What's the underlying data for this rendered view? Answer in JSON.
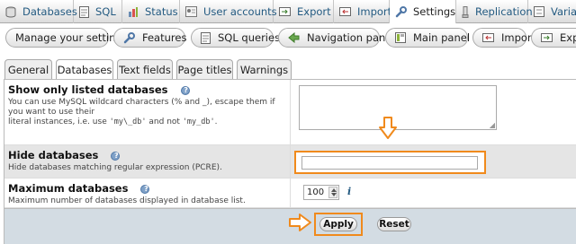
{
  "top_tabs": [
    {
      "label": "Databases",
      "icon": "database-icon"
    },
    {
      "label": "SQL",
      "icon": "sql-icon"
    },
    {
      "label": "Status",
      "icon": "status-icon"
    },
    {
      "label": "User accounts",
      "icon": "users-icon"
    },
    {
      "label": "Export",
      "icon": "export-icon"
    },
    {
      "label": "Import",
      "icon": "import-icon"
    },
    {
      "label": "Settings",
      "icon": "wrench-icon",
      "active": true
    },
    {
      "label": "Replication",
      "icon": "replication-icon"
    },
    {
      "label": "Variab",
      "icon": "variables-icon"
    }
  ],
  "sub_nav": [
    {
      "label": "Manage your settings"
    },
    {
      "label": "Features",
      "icon": "wrench-icon"
    },
    {
      "label": "SQL queries",
      "icon": "sql-icon"
    },
    {
      "label": "Navigation panel",
      "icon": "navigation-icon"
    },
    {
      "label": "Main panel",
      "icon": "main-panel-icon"
    },
    {
      "label": "Import",
      "icon": "import-icon"
    },
    {
      "label": "Expo",
      "icon": "export-icon"
    }
  ],
  "inner_tabs": [
    {
      "label": "General"
    },
    {
      "label": "Databases",
      "active": true
    },
    {
      "label": "Text fields"
    },
    {
      "label": "Page titles"
    },
    {
      "label": "Warnings"
    }
  ],
  "fields": {
    "only_db": {
      "label": "Show only listed databases",
      "desc_1": "You can use MySQL wildcard characters (% and _), escape them if you want to use their",
      "desc_2a": "literal instances, i.e. use ",
      "code_1": "'my\\_db'",
      "desc_2b": " and not ",
      "code_2": "'my_db'",
      "desc_2c": ".",
      "value": ""
    },
    "hide_db": {
      "label": "Hide databases",
      "desc": "Hide databases matching regular expression (PCRE).",
      "value": ""
    },
    "max_db": {
      "label": "Maximum databases",
      "desc": "Maximum number of databases displayed in database list.",
      "value": "100",
      "info": "i"
    }
  },
  "buttons": {
    "apply": "Apply",
    "reset": "Reset"
  },
  "colors": {
    "highlight": "#f08a1c",
    "link": "#235a81",
    "footer": "#d3dce3"
  }
}
